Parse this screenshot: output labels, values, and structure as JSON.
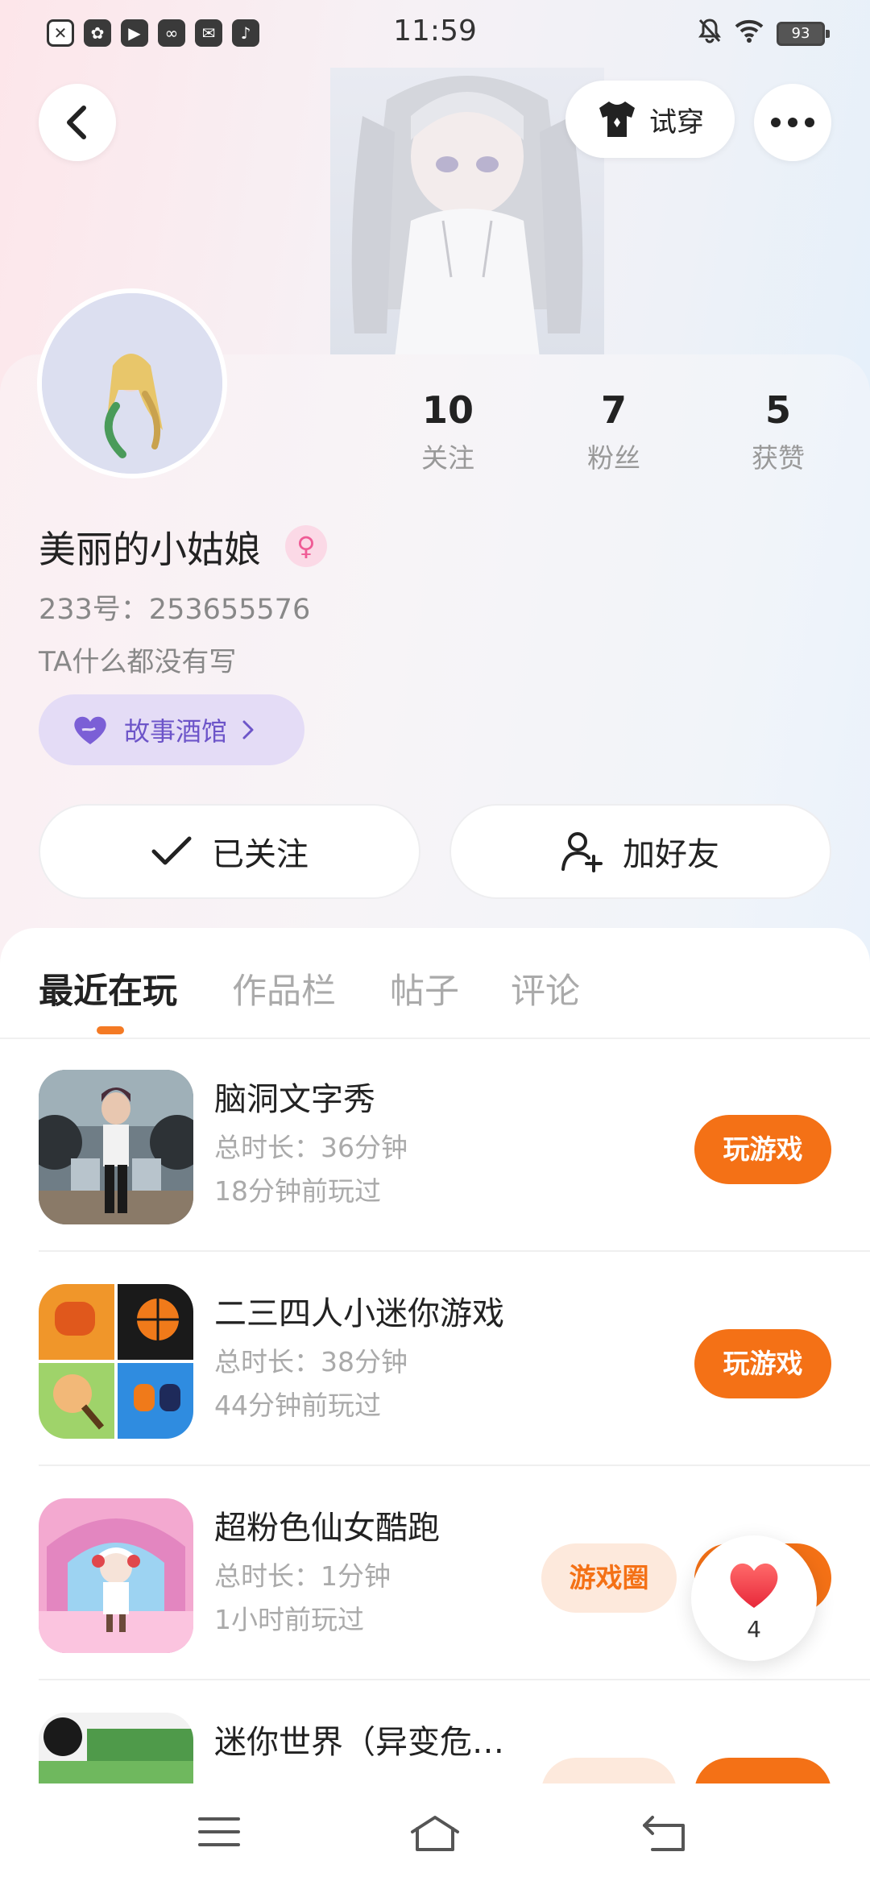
{
  "status_bar": {
    "time": "11:59",
    "battery": "93",
    "app_icons": [
      "x-icon",
      "fan-icon",
      "video-icon",
      "link-icon",
      "mail-icon",
      "tiktok-icon"
    ],
    "right_icons": [
      "mute-bell-icon",
      "wifi-icon",
      "battery-icon"
    ]
  },
  "header": {
    "back_icon": "back-arrow-icon",
    "tryon_label": "试穿",
    "more_icon": "more-dots-icon"
  },
  "profile": {
    "stats": [
      {
        "num": "10",
        "label": "关注"
      },
      {
        "num": "7",
        "label": "粉丝"
      },
      {
        "num": "5",
        "label": "获赞"
      }
    ],
    "nickname": "美丽的小姑娘",
    "gender": "♀",
    "uid": "233号：253655576",
    "bio": "TA什么都没有写",
    "story_label": "故事酒馆",
    "follow_label": "已关注",
    "add_friend_label": "加好友"
  },
  "tabs": [
    {
      "label": "最近在玩"
    },
    {
      "label": "作品栏"
    },
    {
      "label": "帖子"
    },
    {
      "label": "评论"
    }
  ],
  "games": [
    {
      "title": "脑洞文字秀",
      "duration": "总时长：36分钟",
      "last_played": "18分钟前玩过",
      "play_label": "玩游戏"
    },
    {
      "title": "二三四人小迷你游戏",
      "duration": "总时长：38分钟",
      "last_played": "44分钟前玩过",
      "play_label": "玩游戏"
    },
    {
      "title": "超粉色仙女酷跑",
      "duration": "总时长：1分钟",
      "last_played": "1小时前玩过",
      "circle_label": "游戏圈",
      "play_label": "玩游戏"
    },
    {
      "title": "迷你世界（异变危…",
      "duration": "",
      "last_played": ""
    }
  ],
  "like_button": {
    "count": "4"
  },
  "colors": {
    "accent": "#f47116",
    "story_purple": "#6d55c9",
    "gender_pink": "#ef5b95"
  }
}
